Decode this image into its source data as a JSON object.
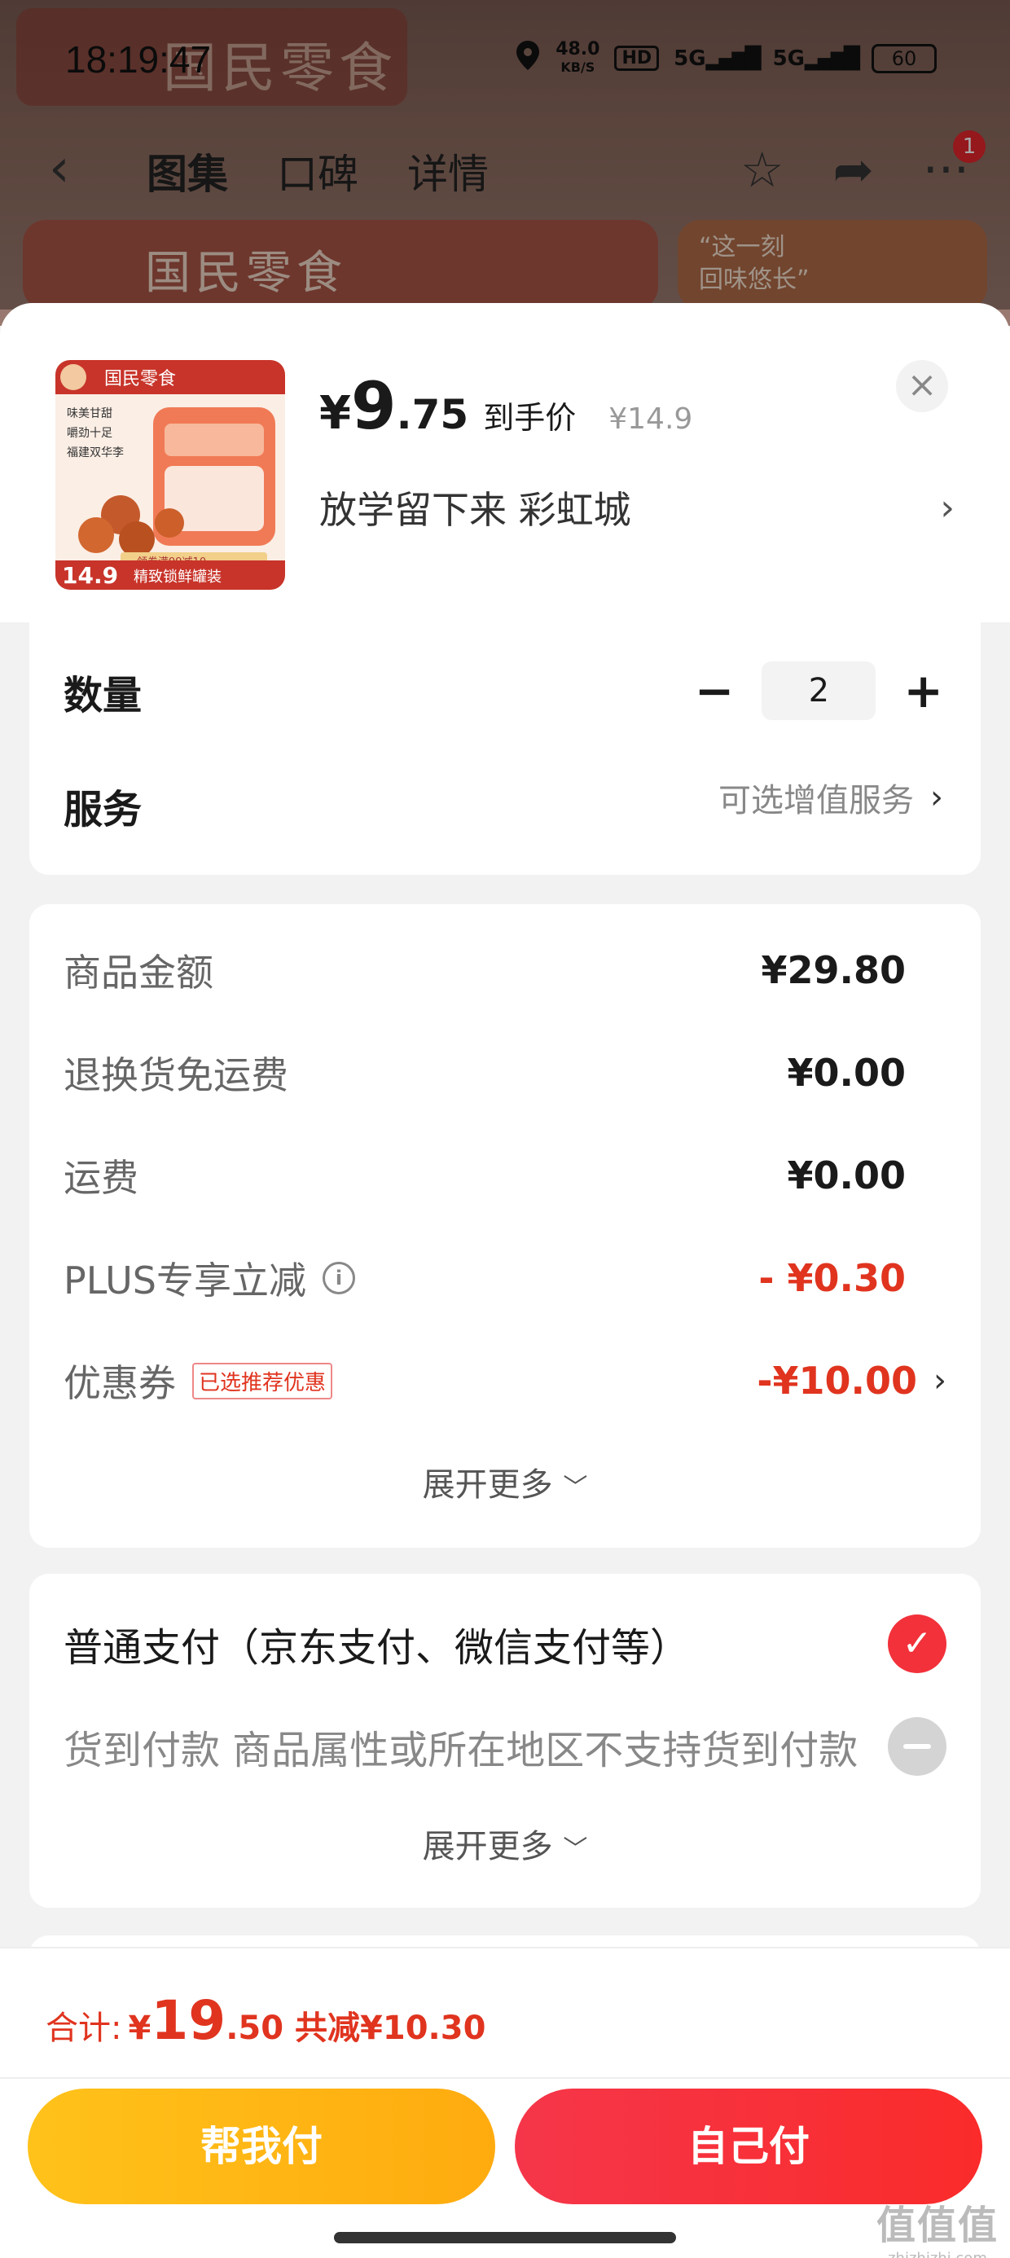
{
  "statusbar": {
    "time": "18:19:47",
    "speed": "48.0",
    "speed_unit": "KB/S",
    "hd": "HD",
    "net1": "5G",
    "net2": "5G",
    "battery": "60"
  },
  "background": {
    "brand": "国民零食",
    "nav_tabs": [
      "图集",
      "口碑",
      "详情"
    ],
    "badge": "1",
    "promo_line1": "“这一刻",
    "promo_line2": "回味悠长”"
  },
  "product": {
    "thumb_brand": "国民零食",
    "thumb_features": [
      "味美甘甜",
      "嚼劲十足",
      "福建双华李"
    ],
    "thumb_price": "14.9",
    "thumb_tag": "精致锁鲜罐装",
    "thumb_promo": "领券满99减10",
    "price_yen": "¥",
    "price_int": "9",
    "price_dec": ".75",
    "price_label": "到手价",
    "orig_price": "¥14.9",
    "variant": "放学留下来  彩虹城"
  },
  "quantity": {
    "label": "数量",
    "minus": "−",
    "value": "2",
    "plus": "+"
  },
  "service": {
    "label": "服务",
    "value": "可选增值服务"
  },
  "pricing": {
    "items": [
      {
        "label": "商品金额",
        "value": "¥29.80"
      },
      {
        "label": "退换货免运费",
        "value": "¥0.00"
      },
      {
        "label": "运费",
        "value": "¥0.00"
      },
      {
        "label": "PLUS专享立减",
        "value": "- ¥0.30"
      }
    ],
    "coupon_label": "优惠券",
    "coupon_tag": "已选推荐优惠",
    "coupon_value": "-¥10.00",
    "expand": "展开更多"
  },
  "payment": {
    "option1": "普通支付（京东支付、微信支付等）",
    "option2": "货到付款 商品属性或所在地区不支持货到付款",
    "expand": "展开更多"
  },
  "footer": {
    "total_label": "合计:",
    "total_yen": "¥",
    "total_int": "19",
    "total_dec": ".50",
    "saved": "共减¥10.30",
    "help_pay": "帮我付",
    "self_pay": "自己付",
    "watermark": "值值值",
    "watermark_url": "zhizhizhi.com"
  },
  "colors": {
    "accent_red": "#e0341f",
    "button_red": "#f5364a",
    "button_yellow": "#ffc21a"
  }
}
